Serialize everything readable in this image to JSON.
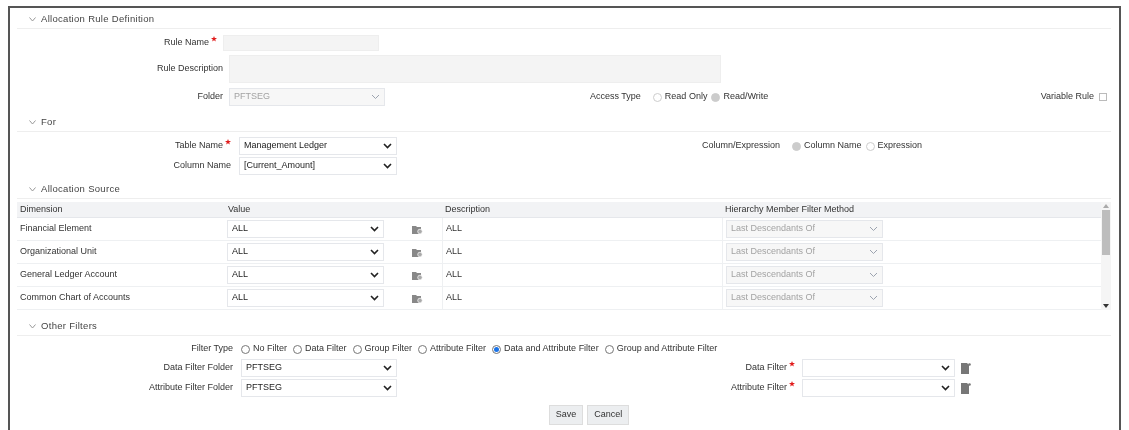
{
  "sections": [
    {
      "title": "Allocation Rule Definition",
      "expanded": true
    },
    {
      "title": "For",
      "expanded": true
    },
    {
      "title": "Allocation Source",
      "expanded": true
    },
    {
      "title": "Other Filters",
      "expanded": true
    }
  ],
  "definition": {
    "rule_name": {
      "label": "Rule Name",
      "required": true
    },
    "rule_description": {
      "label": "Rule Description"
    },
    "folder": {
      "label": "Folder",
      "value": "PFTSEG",
      "disabled": true
    },
    "access_type": {
      "label": "Access Type",
      "options": [
        {
          "label": "Read Only",
          "selected": false
        },
        {
          "label": "Read/Write",
          "selected": true
        }
      ],
      "disabled": true
    },
    "variable_rule": {
      "label": "Variable Rule",
      "checked": false
    }
  },
  "for": {
    "table_name": {
      "label": "Table Name",
      "required": true,
      "value": "Management Ledger"
    },
    "column_name": {
      "label": "Column Name",
      "value": "[Current_Amount]"
    },
    "column_expression": {
      "label": "Column/Expression",
      "options": [
        {
          "label": "Column Name",
          "selected": true
        },
        {
          "label": "Expression",
          "selected": false
        }
      ],
      "disabled": true
    }
  },
  "source": {
    "columns": [
      "Dimension",
      "Value",
      "Description",
      "Hierarchy Member Filter Method"
    ],
    "rows": [
      {
        "dimension": "Financial Element",
        "value": "ALL",
        "description": "ALL",
        "method": "Last Descendants Of",
        "method_disabled": true
      },
      {
        "dimension": "Organizational Unit",
        "value": "ALL",
        "description": "ALL",
        "method": "Last Descendants Of",
        "method_disabled": true
      },
      {
        "dimension": "General Ledger Account",
        "value": "ALL",
        "description": "ALL",
        "method": "Last Descendants Of",
        "method_disabled": true
      },
      {
        "dimension": "Common Chart of Accounts",
        "value": "ALL",
        "description": "ALL",
        "method": "Last Descendants Of",
        "method_disabled": true
      }
    ]
  },
  "filters": {
    "filter_type": {
      "label": "Filter Type",
      "options": [
        {
          "label": "No Filter",
          "selected": false
        },
        {
          "label": "Data Filter",
          "selected": false
        },
        {
          "label": "Group Filter",
          "selected": false
        },
        {
          "label": "Attribute Filter",
          "selected": false
        },
        {
          "label": "Data and Attribute Filter",
          "selected": true
        },
        {
          "label": "Group and Attribute Filter",
          "selected": false
        }
      ]
    },
    "data_filter_folder": {
      "label": "Data Filter Folder",
      "value": "PFTSEG"
    },
    "attribute_filter_folder": {
      "label": "Attribute Filter  Folder",
      "value": "PFTSEG"
    },
    "data_filter": {
      "label": "Data Filter",
      "required": true
    },
    "attribute_filter": {
      "label": "Attribute Filter",
      "required": true
    }
  },
  "buttons": [
    "Save",
    "Cancel"
  ]
}
